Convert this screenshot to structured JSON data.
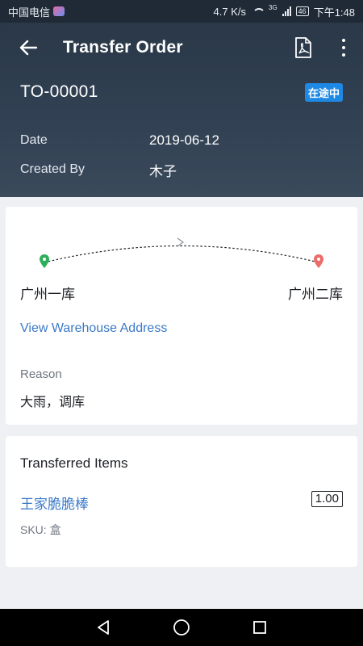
{
  "status_bar": {
    "carrier": "中国电信",
    "network_speed": "4.7 K/s",
    "network_type": "3G",
    "battery": "46",
    "time": "下午1:48"
  },
  "app_bar": {
    "title": "Transfer Order",
    "back_icon": "arrow-left-icon",
    "pdf_icon": "pdf-icon",
    "more_icon": "more-vertical-icon"
  },
  "order": {
    "number": "TO-00001",
    "status": "在途中",
    "status_color": "#1e88e5",
    "date_label": "Date",
    "date": "2019-06-12",
    "created_by_label": "Created By",
    "created_by": "木子"
  },
  "route": {
    "from": "广州一库",
    "to": "广州二库",
    "from_pin_color": "#2eae5b",
    "to_pin_color": "#ec6b6b",
    "view_address_label": "View Warehouse Address",
    "reason_label": "Reason",
    "reason": "大雨，调库"
  },
  "items": {
    "section_title": "Transferred Items",
    "list": [
      {
        "name": "王家脆脆棒",
        "quantity": "1.00",
        "sku_label": "SKU: 盒"
      }
    ]
  },
  "nav_bar": {
    "back_icon": "triangle-back-icon",
    "home_icon": "circle-home-icon",
    "recents_icon": "square-recents-icon"
  }
}
